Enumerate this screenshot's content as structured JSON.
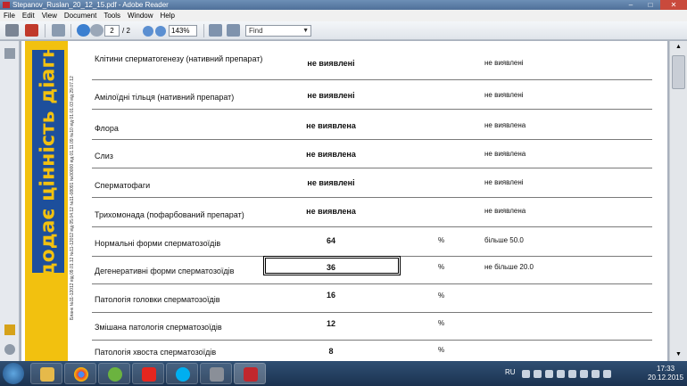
{
  "window": {
    "title": "Stepanov_Ruslan_20_12_15.pdf - Adobe Reader",
    "controls": {
      "minimize": "–",
      "maximize": "□",
      "close": "✕"
    }
  },
  "menu": [
    "File",
    "Edit",
    "View",
    "Document",
    "Tools",
    "Window",
    "Help"
  ],
  "toolbar": {
    "current_page": "2",
    "total_pages": "/ 2",
    "zoom": "143%",
    "find_placeholder": "Find"
  },
  "document": {
    "side_banner_text": "додає цінність діагн",
    "stamp_text": "Бланк №11-12012 від 09.01.12 №11-12012 від 05.04.12 №11-08091 №00000 від 01.11.09 №10 від 01.01.03 від 29.07.12",
    "rows": [
      {
        "name": "Клітини сперматогенезу (нативний препарат)",
        "value": "не виявлені",
        "unit": "",
        "norm": "не виявлені"
      },
      {
        "name": "Амілоїдні тільця (нативний препарат)",
        "value": "не виявлені",
        "unit": "",
        "norm": "не виявлені"
      },
      {
        "name": "Флора",
        "value": "не виявлена",
        "unit": "",
        "norm": "не виявлена"
      },
      {
        "name": "Слиз",
        "value": "не виявлена",
        "unit": "",
        "norm": "не виявлена"
      },
      {
        "name": "Сперматофаги",
        "value": "не виявлені",
        "unit": "",
        "norm": "не виявлені"
      },
      {
        "name": "Трихомонада (пофарбований препарат)",
        "value": "не виявлена",
        "unit": "",
        "norm": "не виявлена"
      },
      {
        "name": "Нормальні форми сперматозоїдів",
        "value": "64",
        "unit": "%",
        "norm": "більше 50.0"
      },
      {
        "name": "Дегенеративні форми сперматозоїдів",
        "value": "36",
        "unit": "%",
        "norm": "не більше 20.0"
      },
      {
        "name": "Патологія головки сперматозоїдів",
        "value": "16",
        "unit": "%",
        "norm": ""
      },
      {
        "name": "Змішана патологія сперматозоїдів",
        "value": "12",
        "unit": "%",
        "norm": ""
      },
      {
        "name": "Патологія хвоста сперматозоїдів",
        "value": "8",
        "unit": "%",
        "norm": ""
      }
    ]
  },
  "taskbar": {
    "language": "RU",
    "time": "17:33",
    "date": "20.12.2015"
  },
  "colors": {
    "banner_yellow": "#f2c10f",
    "banner_blue": "#1d4f9c",
    "taskbar": "#1b3250"
  }
}
